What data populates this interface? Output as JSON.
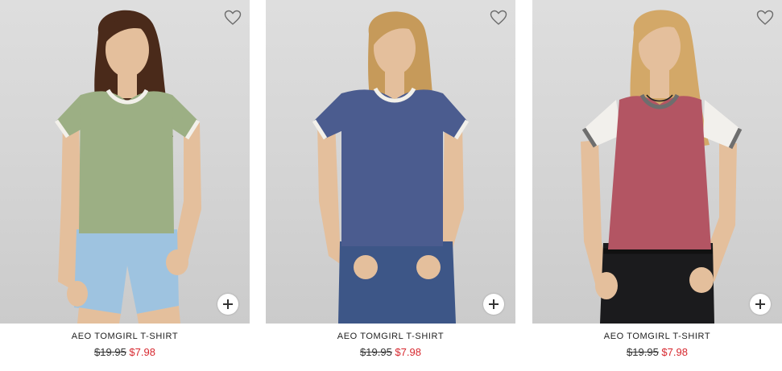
{
  "accent_colors": {
    "sale_price": "#d7282f",
    "text": "#222222",
    "photo_background": "#d8d8d8"
  },
  "products": [
    {
      "name": "AEO TOMGIRL T-SHIRT",
      "original_price": "$19.95",
      "sale_price": "$7.98",
      "shirt_color": "#9caf84",
      "sleeve_color": "#9caf84",
      "trim_color": "#f2f0ea",
      "bottom_color": "#9ec3e0",
      "hair_color": "#4a2a1a",
      "favorite_icon": "heart-outline-icon",
      "quick_add_icon": "plus-icon"
    },
    {
      "name": "AEO TOMGIRL T-SHIRT",
      "original_price": "$19.95",
      "sale_price": "$7.98",
      "shirt_color": "#4b5c8f",
      "sleeve_color": "#4b5c8f",
      "trim_color": "#f2f0ea",
      "bottom_color": "#3d5687",
      "hair_color": "#c69a5a",
      "favorite_icon": "heart-outline-icon",
      "quick_add_icon": "plus-icon"
    },
    {
      "name": "AEO TOMGIRL T-SHIRT",
      "original_price": "$19.95",
      "sale_price": "$7.98",
      "shirt_color": "#b35563",
      "sleeve_color": "#f2f0ec",
      "trim_color": "#6e6e6e",
      "bottom_color": "#1b1b1d",
      "hair_color": "#d3a868",
      "favorite_icon": "heart-outline-icon",
      "quick_add_icon": "plus-icon"
    }
  ]
}
